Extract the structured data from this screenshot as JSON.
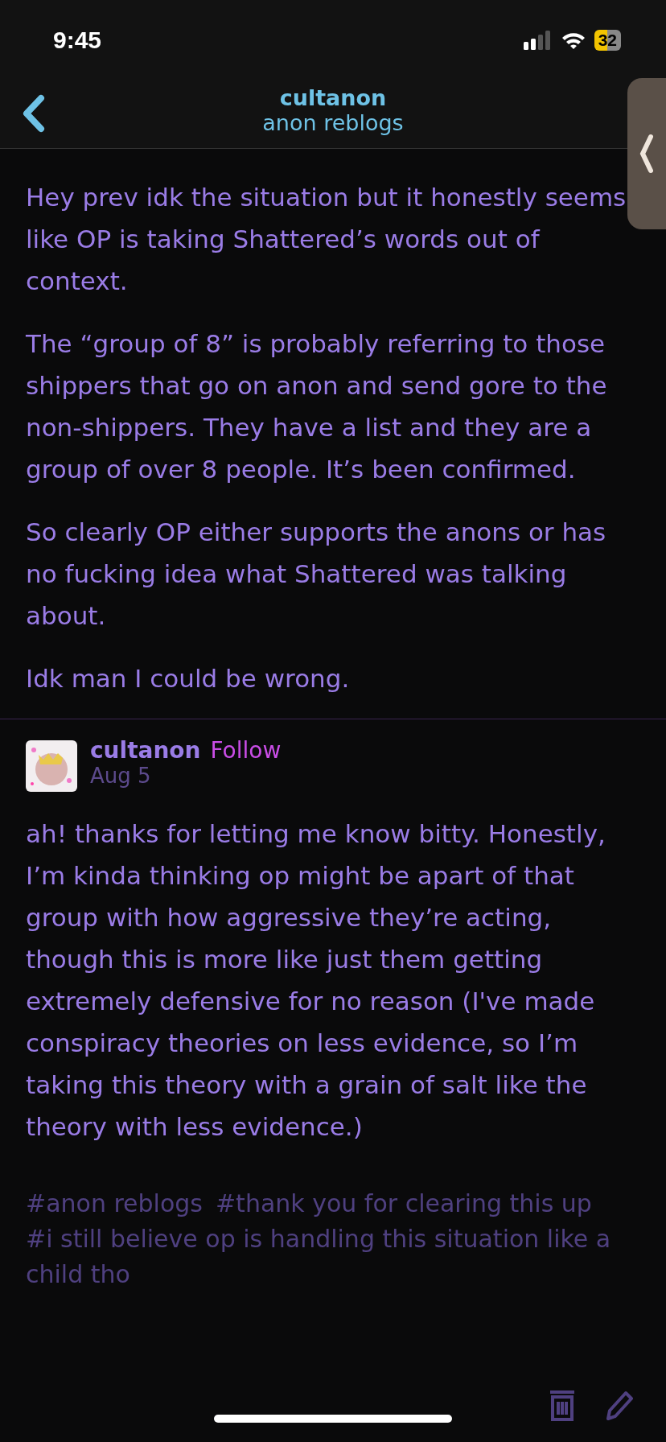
{
  "status_bar": {
    "time": "9:45",
    "battery": "32"
  },
  "header": {
    "title": "cultanon",
    "subtitle": "anon reblogs"
  },
  "posts": [
    {
      "paragraphs": [
        "Hey prev idk the situation but it honestly seems like OP is taking Shattered’s words out of context.",
        "The “group of 8” is probably referring to those shippers that go on anon and send gore to the non-shippers. They have a list and they are a group of over 8 people. It’s been confirmed.",
        "So clearly OP either supports the anons or has no fucking idea what Shattered was talking about.",
        "Idk man I could be wrong."
      ]
    },
    {
      "username": "cultanon",
      "follow": "Follow",
      "date": "Aug 5",
      "paragraphs": [
        "ah! thanks for letting me know bitty. Honestly, I’m kinda thinking op might be apart of that group with how aggressive they’re acting, though this is more like just them getting extremely defensive for no reason (I've made conspiracy theories on less evidence, so I’m taking this theory with a grain of salt like the theory with less evidence.)"
      ],
      "tags": [
        "#anon reblogs",
        "#thank you for clearing this up",
        "#i still believe op is handling this situation like a child tho"
      ]
    }
  ]
}
